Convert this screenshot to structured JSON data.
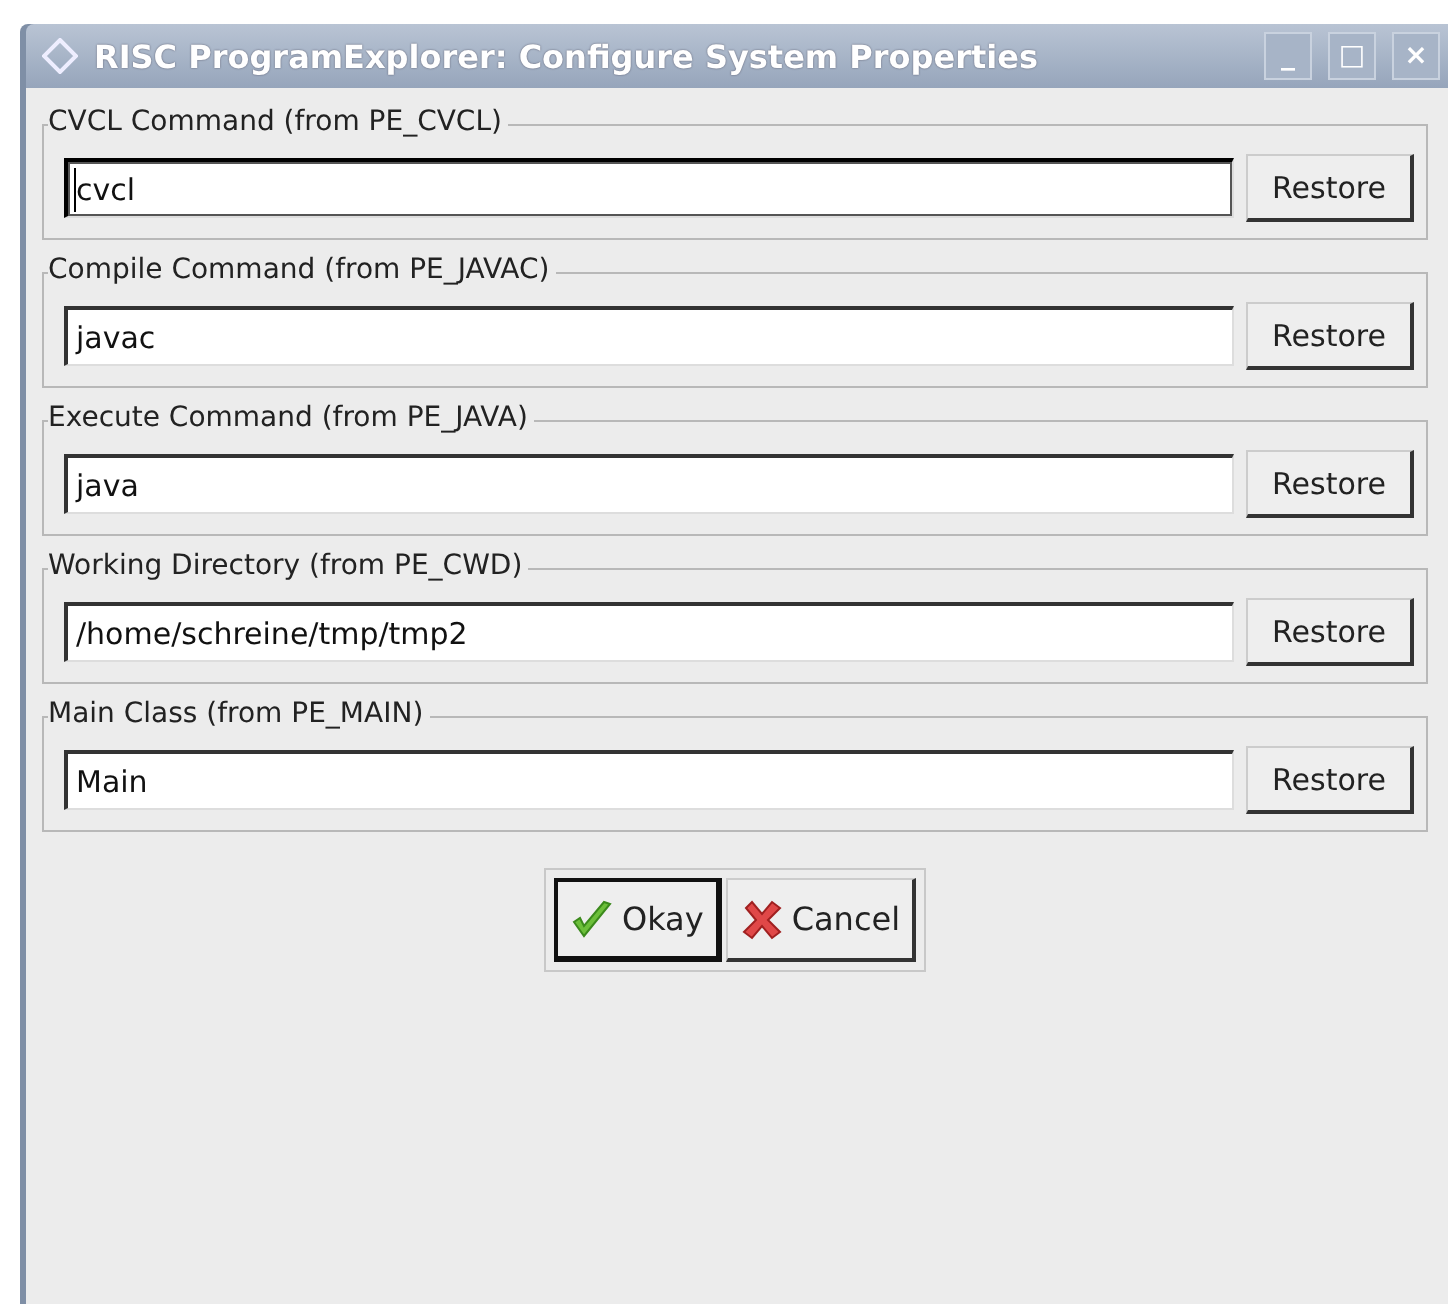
{
  "window": {
    "title": "RISC ProgramExplorer: Configure System Properties",
    "controls": [
      "_",
      "□",
      "×"
    ]
  },
  "groups": [
    {
      "label": "CVCL Command (from PE_CVCL)",
      "value": "cvcl",
      "focused": true,
      "button": "Restore"
    },
    {
      "label": "Compile Command (from PE_JAVAC)",
      "value": "javac",
      "focused": false,
      "button": "Restore"
    },
    {
      "label": "Execute Command (from PE_JAVA)",
      "value": "java",
      "focused": false,
      "button": "Restore"
    },
    {
      "label": "Working Directory (from PE_CWD)",
      "value": "/home/schreine/tmp/tmp2",
      "focused": false,
      "button": "Restore"
    },
    {
      "label": "Main Class (from PE_MAIN)",
      "value": "Main",
      "focused": false,
      "button": "Restore"
    }
  ],
  "buttons": [
    {
      "label": "Okay",
      "kind": "ok",
      "default": true
    },
    {
      "label": "Cancel",
      "kind": "cancel",
      "default": false
    }
  ]
}
